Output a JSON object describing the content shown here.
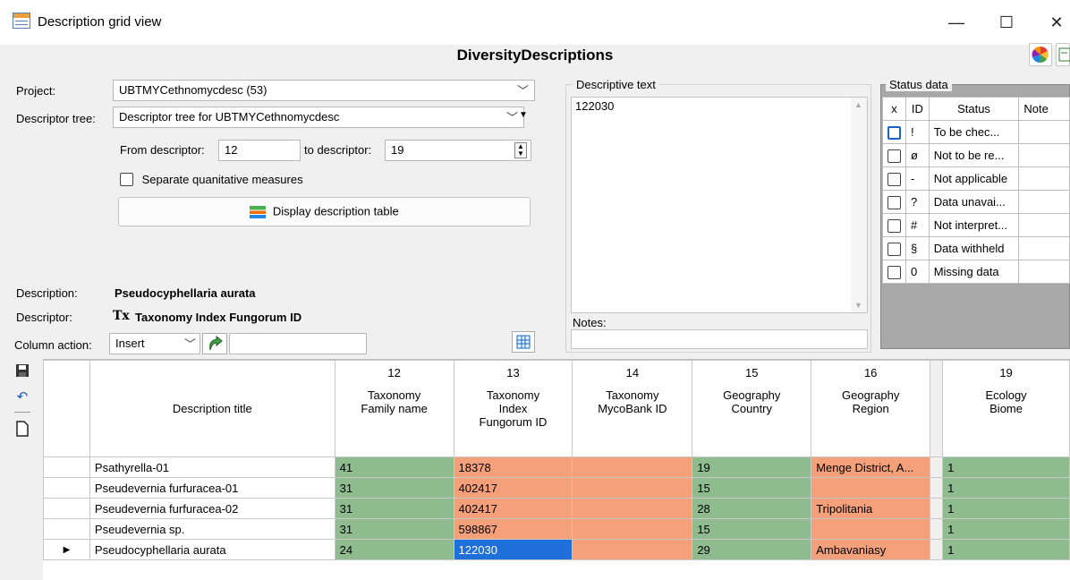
{
  "window": {
    "title": "Description grid view",
    "minimize": "—",
    "maximize": "☐",
    "close": "✕"
  },
  "app": {
    "title": "DiversityDescriptions"
  },
  "form": {
    "project_label": "Project:",
    "project_value": "UBTMYCethnomycdesc (53)",
    "tree_label": "Descriptor tree:",
    "tree_value": "Descriptor tree for UBTMYCethnomycdesc",
    "from_label": "From descriptor:",
    "from_value": "12",
    "to_label": "to descriptor:",
    "to_value": "19",
    "separate_label": "Separate quanitative measures",
    "display_button": "Display description table",
    "description_label": "Description:",
    "description_value": "Pseudocyphellaria aurata",
    "descriptor_label": "Descriptor:",
    "descriptor_prefix": "Tx",
    "descriptor_value": "Taxonomy Index Fungorum ID",
    "column_action_label": "Column action:",
    "column_action_value": "Insert",
    "column_action_input": ""
  },
  "descriptive": {
    "label": "Descriptive text",
    "text": "122030",
    "notes_label": "Notes:"
  },
  "status": {
    "label": "Status data",
    "headers": [
      "x",
      "ID",
      "Status",
      "Note"
    ],
    "rows": [
      {
        "id": "!",
        "status": "To be chec..."
      },
      {
        "id": "ø",
        "status": "Not to be re..."
      },
      {
        "id": "-",
        "status": "Not applicable"
      },
      {
        "id": "?",
        "status": "Data unavai..."
      },
      {
        "id": "#",
        "status": "Not interpret..."
      },
      {
        "id": "§",
        "status": "Data withheld"
      },
      {
        "id": "0",
        "status": "Missing data"
      }
    ]
  },
  "grid": {
    "title_header": "Description title",
    "columns": [
      {
        "num": "12",
        "l1": "Taxonomy",
        "l2": "Family name",
        "l3": ""
      },
      {
        "num": "13",
        "l1": "Taxonomy",
        "l2": "Index",
        "l3": "Fungorum ID"
      },
      {
        "num": "14",
        "l1": "Taxonomy",
        "l2": "MycoBank ID",
        "l3": ""
      },
      {
        "num": "15",
        "l1": "Geography",
        "l2": "Country",
        "l3": ""
      },
      {
        "num": "16",
        "l1": "Geography",
        "l2": "Region",
        "l3": ""
      },
      {
        "num": "19",
        "l1": "Ecology",
        "l2": "Biome",
        "l3": ""
      }
    ],
    "rows": [
      {
        "title": "Psathyrella-01",
        "c12": "41",
        "c13": "18378",
        "c14": "",
        "c15": "19",
        "c16": "Menge District, A...",
        "c19": "1"
      },
      {
        "title": "Pseudevernia furfuracea-01",
        "c12": "31",
        "c13": "402417",
        "c14": "",
        "c15": "15",
        "c16": "",
        "c19": "1"
      },
      {
        "title": "Pseudevernia furfuracea-02",
        "c12": "31",
        "c13": "402417",
        "c14": "",
        "c15": "28",
        "c16": "Tripolitania",
        "c19": "1"
      },
      {
        "title": "Pseudevernia sp.",
        "c12": "31",
        "c13": "598867",
        "c14": "",
        "c15": "15",
        "c16": "",
        "c19": "1"
      },
      {
        "title": "Pseudocyphellaria aurata",
        "c12": "24",
        "c13": "122030",
        "c14": "",
        "c15": "29",
        "c16": "Ambavaniasy",
        "c19": "1"
      }
    ]
  },
  "colors": {
    "green": "#8fbc8f",
    "orange": "#f4a07a",
    "selected": "#1e6fd9"
  }
}
